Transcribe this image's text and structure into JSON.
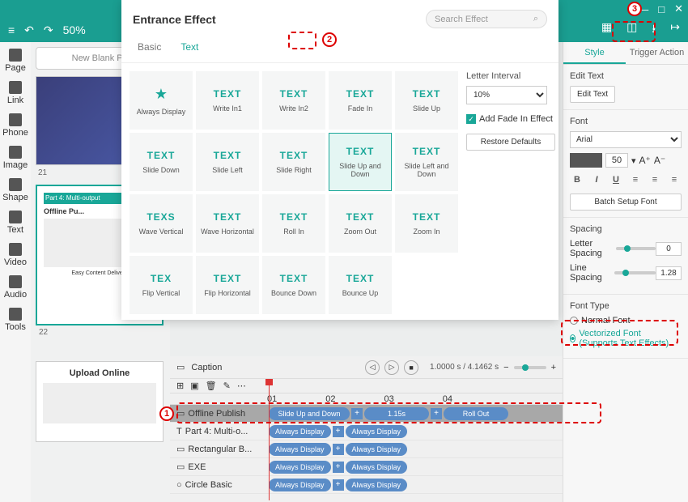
{
  "titlebar": {
    "min": "—",
    "max": "□",
    "close": "✕"
  },
  "toolbar": {
    "menu": "≡",
    "undo": "↶",
    "redo": "↷",
    "zoom": "50%",
    "saveGroup": [
      "▢",
      "▢"
    ],
    "export": "↦"
  },
  "sidebar": [
    {
      "label": "Page"
    },
    {
      "label": "Link"
    },
    {
      "label": "Phone"
    },
    {
      "label": "Image"
    },
    {
      "label": "Shape"
    },
    {
      "label": "Text"
    },
    {
      "label": "Video"
    },
    {
      "label": "Audio"
    },
    {
      "label": "Tools"
    }
  ],
  "pagepanel": {
    "newBlank": "New Blank P...",
    "thumb1Label": "21",
    "thumb2Header": "Part 4: Multi-output",
    "thumb2Sub": "Offline Pu...",
    "thumb2Caption": "Easy Content Delivery",
    "thumb2Label": "22",
    "upload": "Upload Online"
  },
  "modal": {
    "title": "Entrance Effect",
    "searchPlaceholder": "Search Effect",
    "tabs": [
      "Basic",
      "Text"
    ],
    "effects": [
      "Always Display",
      "Write In1",
      "Write In2",
      "Fade In",
      "Slide Up",
      "Slide Down",
      "Slide Left",
      "Slide Right",
      "Slide Up and Down",
      "Slide Left and Down",
      "Wave Vertical",
      "Wave Horizontal",
      "Roll In",
      "Zoom Out",
      "Zoom In",
      "Flip Vertical",
      "Flip Horizontal",
      "Bounce Down",
      "Bounce Up"
    ],
    "letterIntervalLabel": "Letter Interval",
    "letterInterval": "10%",
    "addFade": "Add Fade In Effect",
    "restore": "Restore Defaults"
  },
  "right": {
    "tabs": [
      "Style",
      "Trigger Action"
    ],
    "editTextTitle": "Edit Text",
    "editTextBtn": "Edit Text",
    "fontTitle": "Font",
    "fontName": "Arial",
    "fontSize": "50",
    "batchBtn": "Batch Setup Font",
    "spacingTitle": "Spacing",
    "letterSpacing": "Letter Spacing",
    "letterVal": "0",
    "lineSpacing": "Line Spacing",
    "lineVal": "1.28",
    "fontTypeTitle": "Font Type",
    "normalFont": "Normal Font",
    "vectorFont": "Vectorized Font (Supports Text Effects)"
  },
  "timeline": {
    "caption": "Caption",
    "time": "1.0000 s / 4.1462 s",
    "ticks": [
      "01",
      "02",
      "03",
      "04"
    ],
    "rows": [
      {
        "name": "Offline Publish",
        "pills": [
          "Slide Up and Down",
          "1.15s",
          "Roll Out"
        ],
        "sel": true
      },
      {
        "name": "Part 4: Multi-o...",
        "pills": [
          "Always Display",
          "Always Display"
        ]
      },
      {
        "name": "Rectangular B...",
        "pills": [
          "Always Display",
          "Always Display"
        ]
      },
      {
        "name": "EXE",
        "pills": [
          "Always Display",
          "Always Display"
        ]
      },
      {
        "name": "Circle Basic",
        "pills": [
          "Always Display",
          "Always Display"
        ]
      }
    ]
  },
  "annotations": {
    "a1": "1",
    "a2": "2",
    "a3": "3"
  }
}
